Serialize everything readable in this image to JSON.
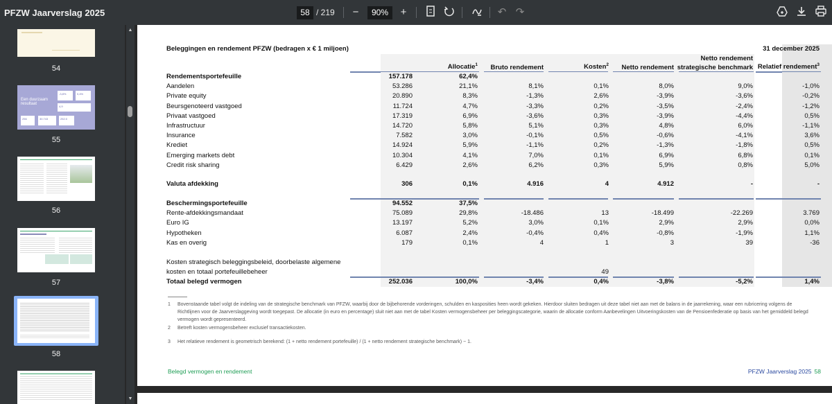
{
  "toolbar": {
    "title": "PFZW Jaarverslag 2025",
    "page_current": "58",
    "page_total": "/ 219",
    "zoom": "90%",
    "icons": [
      "minus-icon",
      "plus-icon",
      "fit-page-icon",
      "rotate-icon",
      "annotate-icon",
      "undo-icon",
      "redo-icon",
      "drive-icon",
      "download-icon",
      "print-icon"
    ]
  },
  "sidebar": {
    "thumbnails": [
      {
        "label": "54"
      },
      {
        "label": "55"
      },
      {
        "label": "56"
      },
      {
        "label": "57"
      },
      {
        "label": "58",
        "selected": true
      }
    ],
    "thumb55_text": {
      "big": "Een duurzaam resultaat",
      "v1": "-3,8%",
      "v2": "0,4%",
      "v3": "4,9",
      "v4": "256",
      "v5": "30.743",
      "v6": "252.0"
    }
  },
  "table": {
    "title": "Beleggingen en rendement PFZW (bedragen x € 1 miljoen)",
    "date_header": "31 december 2025",
    "headers": {
      "allocatie": "Allocatie",
      "allocatie_sup": "1",
      "bruto": "Bruto rendement",
      "kosten": "Kosten",
      "kosten_sup": "2",
      "netto": "Netto rendement",
      "benchmark_line1": "Netto rendement",
      "benchmark_line2": "strategische benchmark",
      "relatief": "Relatief rendement",
      "relatief_sup": "3"
    },
    "rows": [
      {
        "label": "Rendementsportefeuille",
        "bold": true,
        "c1": "157.178",
        "c2": "62,4%",
        "c3": "",
        "c4": "",
        "c5": "",
        "c6": "",
        "c7": ""
      },
      {
        "label": "Aandelen",
        "c1": "53.286",
        "c2": "21,1%",
        "c3": "8,1%",
        "c4": "0,1%",
        "c5": "8,0%",
        "c6": "9,0%",
        "c7": "-1,0%"
      },
      {
        "label": "Private equity",
        "c1": "20.890",
        "c2": "8,3%",
        "c3": "-1,3%",
        "c4": "2,6%",
        "c5": "-3,9%",
        "c6": "-3,6%",
        "c7": "-0,2%"
      },
      {
        "label": "Beursgenoteerd vastgoed",
        "c1": "11.724",
        "c2": "4,7%",
        "c3": "-3,3%",
        "c4": "0,2%",
        "c5": "-3,5%",
        "c6": "-2,4%",
        "c7": "-1,2%"
      },
      {
        "label": "Privaat vastgoed",
        "c1": "17.319",
        "c2": "6,9%",
        "c3": "-3,6%",
        "c4": "0,3%",
        "c5": "-3,9%",
        "c6": "-4,4%",
        "c7": "0,5%"
      },
      {
        "label": "Infrastructuur",
        "c1": "14.720",
        "c2": "5,8%",
        "c3": "5,1%",
        "c4": "0,3%",
        "c5": "4,8%",
        "c6": "6,0%",
        "c7": "-1,1%"
      },
      {
        "label": "Insurance",
        "c1": "7.582",
        "c2": "3,0%",
        "c3": "-0,1%",
        "c4": "0,5%",
        "c5": "-0,6%",
        "c6": "-4,1%",
        "c7": "3,6%"
      },
      {
        "label": "Krediet",
        "c1": "14.924",
        "c2": "5,9%",
        "c3": "-1,1%",
        "c4": "0,2%",
        "c5": "-1,3%",
        "c6": "-1,8%",
        "c7": "0,5%"
      },
      {
        "label": "Emerging markets debt",
        "c1": "10.304",
        "c2": "4,1%",
        "c3": "7,0%",
        "c4": "0,1%",
        "c5": "6,9%",
        "c6": "6,8%",
        "c7": "0,1%"
      },
      {
        "label": "Credit risk sharing",
        "c1": "6.429",
        "c2": "2,6%",
        "c3": "6,2%",
        "c4": "0,3%",
        "c5": "5,9%",
        "c6": "0,8%",
        "c7": "5,0%"
      },
      {
        "spacer": true
      },
      {
        "label": "Valuta afdekking",
        "bold": true,
        "c1": "306",
        "c2": "0,1%",
        "c3": "4.916",
        "c4": "4",
        "c5": "4.912",
        "c6": "-",
        "c7": "-"
      },
      {
        "spacer": true
      },
      {
        "label": "Beschermingsportefeuille",
        "bold": true,
        "c1": "94.552",
        "c2": "37,5%",
        "c3": "",
        "c4": "",
        "c5": "",
        "c6": "",
        "c7": "",
        "topline": true
      },
      {
        "label": "Rente-afdekkingsmandaat",
        "c1": "75.089",
        "c2": "29,8%",
        "c3": "-18.486",
        "c4": "13",
        "c5": "-18.499",
        "c6": "-22.269",
        "c7": "3.769"
      },
      {
        "label": "Euro IG",
        "c1": "13.197",
        "c2": "5,2%",
        "c3": "3,0%",
        "c4": "0,1%",
        "c5": "2,9%",
        "c6": "2,9%",
        "c7": "0,0%"
      },
      {
        "label": "Hypotheken",
        "c1": "6.087",
        "c2": "2,4%",
        "c3": "-0,4%",
        "c4": "0,4%",
        "c5": "-0,8%",
        "c6": "-1,9%",
        "c7": "1,1%"
      },
      {
        "label": "Kas en overig",
        "c1": "179",
        "c2": "0,1%",
        "c3": "4",
        "c4": "1",
        "c5": "3",
        "c6": "39",
        "c7": "-36"
      },
      {
        "spacer": true
      },
      {
        "label": "Kosten strategisch beleggingsbeleid, doorbelaste algemene",
        "c1": "",
        "c2": "",
        "c3": "",
        "c4": "",
        "c5": "",
        "c6": "",
        "c7": ""
      },
      {
        "label": "kosten en totaal portefeuillebeheer",
        "c1": "",
        "c2": "",
        "c3": "",
        "c4": "49",
        "c5": "",
        "c6": "",
        "c7": ""
      },
      {
        "label": "Totaal belegd vermogen",
        "bold": true,
        "c1": "252.036",
        "c2": "100,0%",
        "c3": "-3,4%",
        "c4": "0,4%",
        "c5": "-3,8%",
        "c6": "-5,2%",
        "c7": "1,4%",
        "topline": true
      }
    ]
  },
  "footnotes": [
    {
      "n": "1",
      "text": "Bovenstaande tabel volgt de indeling van de strategische benchmark van PFZW, waarbij door de bijbehorende vorderingen, schulden en kasposities heen wordt gekeken. Hierdoor sluiten bedragen uit deze tabel niet aan met de balans in de jaarrekening, waar een rubricering volgens de Richtlijnen voor de Jaarverslaggeving wordt toegepast. De allocatie (in euro en percentage) sluit niet aan met de tabel Kosten vermogensbeheer per beleggingscategorie, waarin de allocatie conform Aanbevelingen Uitvoeringskosten van de Pensioenfederatie op basis van het gemiddeld belegd vermogen wordt gepresenteerd."
    },
    {
      "n": "2",
      "text": "Betreft kosten vermogensbeheer exclusief transactiekosten."
    },
    {
      "n": "3",
      "text": "Het relatieve rendement is geometrisch berekend: (1 + netto rendement portefeuille) / (1 + netto rendement strategische benchmark) − 1."
    }
  ],
  "footer": {
    "left": "Belegd vermogen en rendement",
    "right": "PFZW Jaarverslag 2025",
    "page": "58"
  },
  "colors": {
    "toolbar_bg": "#323639",
    "accent_green": "#1f9d55",
    "accent_blue": "#2b4aa0",
    "header_line": "#6f83ae",
    "selected_thumb": "#8ab4f8"
  }
}
